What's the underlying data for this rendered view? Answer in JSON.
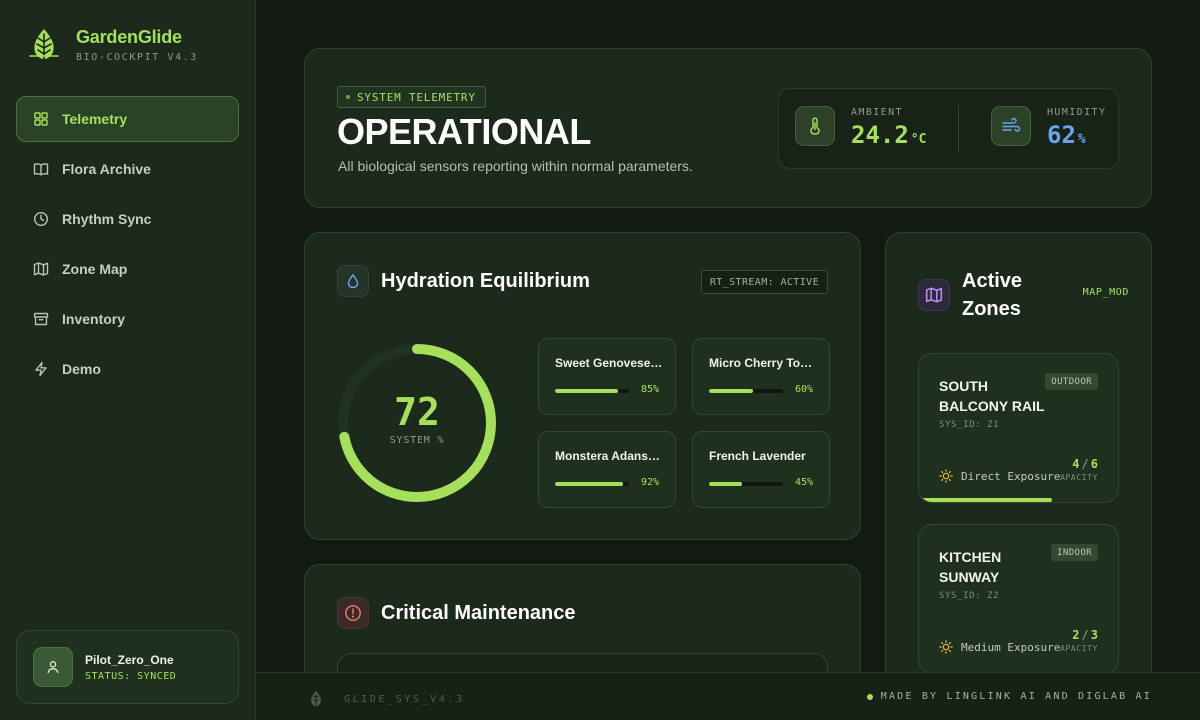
{
  "brand": {
    "name": "GardenGlide",
    "subtitle": "BIO-COCKPIT V4.3"
  },
  "nav": {
    "items": [
      {
        "label": "Telemetry",
        "icon": "grid-icon",
        "active": true
      },
      {
        "label": "Flora Archive",
        "icon": "book-icon"
      },
      {
        "label": "Rhythm Sync",
        "icon": "clock-icon"
      },
      {
        "label": "Zone Map",
        "icon": "map-icon"
      },
      {
        "label": "Inventory",
        "icon": "archive-box-icon"
      },
      {
        "label": "Demo",
        "icon": "lightning-icon"
      }
    ]
  },
  "user": {
    "name": "Pilot_Zero_One",
    "status": "STATUS: SYNCED"
  },
  "hero": {
    "tag": "SYSTEM TELEMETRY",
    "title": "OPERATIONAL",
    "description": "All biological sensors reporting within normal parameters.",
    "ambient": {
      "label": "AMBIENT",
      "value": "24.2",
      "unit": "°C",
      "color": "#a6e05a"
    },
    "humidity": {
      "label": "HUMIDITY",
      "value": "62",
      "unit": "%",
      "color": "#6aa4f0"
    }
  },
  "hydration": {
    "title": "Hydration Equilibrium",
    "stream": "RT_STREAM: ACTIVE",
    "gauge_value": "72",
    "gauge_percent": 72,
    "gauge_label": "SYSTEM %",
    "plants": [
      {
        "name": "Sweet Genovese Basil",
        "percent": 85,
        "percent_label": "85%"
      },
      {
        "name": "Micro Cherry Tomato",
        "percent": 60,
        "percent_label": "60%"
      },
      {
        "name": "Monstera Adansonii",
        "percent": 92,
        "percent_label": "92%"
      },
      {
        "name": "French Lavender",
        "percent": 45,
        "percent_label": "45%"
      }
    ]
  },
  "maintenance": {
    "title": "Critical Maintenance"
  },
  "zones": {
    "title_line1": "Active",
    "title_line2": "Zones",
    "map_mod": "MAP_MOD",
    "items": [
      {
        "name_line1": "SOUTH",
        "name_line2": "BALCONY RAIL",
        "type": "OUTDOOR",
        "sys_id": "SYS_ID: Z1",
        "exposure": "Direct Exposure",
        "cap_used": "4",
        "cap_total": "6",
        "cap_label": "CAPACITY",
        "fill": 0.667
      },
      {
        "name_line1": "KITCHEN",
        "name_line2": "SUNWAY",
        "type": "INDOOR",
        "sys_id": "SYS_ID: Z2",
        "exposure": "Medium Exposure",
        "cap_used": "2",
        "cap_total": "3",
        "cap_label": "CAPACITY",
        "fill": 0.667
      }
    ]
  },
  "footer": {
    "version": "GLIDE_SYS_V4.3",
    "credit": "MADE BY LINGLINK AI AND DIGLAB AI"
  }
}
